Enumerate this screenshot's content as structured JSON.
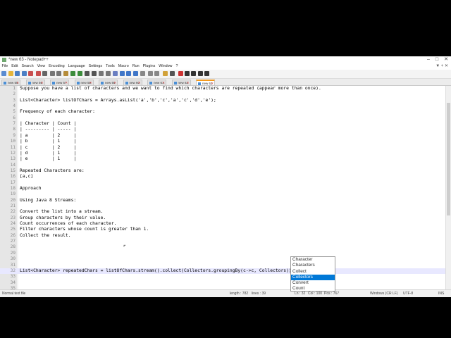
{
  "window": {
    "title": "*new 63 - Notepad++"
  },
  "menu": [
    "File",
    "Edit",
    "Search",
    "View",
    "Encoding",
    "Language",
    "Settings",
    "Tools",
    "Macro",
    "Run",
    "Plugins",
    "Window",
    "?"
  ],
  "tabs": [
    {
      "label": "new 55"
    },
    {
      "label": "new 56"
    },
    {
      "label": "new 57"
    },
    {
      "label": "new 58"
    },
    {
      "label": "new 59"
    },
    {
      "label": "new 60"
    },
    {
      "label": "new 61"
    },
    {
      "label": "new 62"
    },
    {
      "label": "new 63",
      "active": true
    }
  ],
  "lines": [
    "Suppose you have a list of characters and we want to find which characters are repeated (appear more than once).",
    "",
    "List<Character> listOfChars = Arrays.asList('a','b','c','a','c','d','e');",
    "",
    "Frequency of each character:",
    "",
    "| Character | Count |",
    "| --------- | ----- |",
    "| a         | 2     |",
    "| b         | 1     |",
    "| c         | 2     |",
    "| d         | 1     |",
    "| e         | 1     |",
    "",
    "Repeated Characters are:",
    "[a,c]",
    "",
    "Approach",
    "",
    "Using Java 8 Streams:",
    "",
    "Convert the list into a stream.",
    "Group characters by their value.",
    "Count occurrences of each character.",
    "Filter characters whose count is greater than 1.",
    "Collect the result.",
    "",
    "",
    "",
    "",
    "",
    "List<Character> repeatedChars = listOfChars.stream().collect(Collectors.groupingBy(c->c, Collectors))",
    "",
    "",
    "",
    "",
    "",
    "",
    ""
  ],
  "current_line": 32,
  "autocomplete": {
    "options": [
      "Character",
      "Characters",
      "Collect",
      "Collectors",
      "Convert",
      "Count"
    ],
    "selected": "Collectors"
  },
  "status": {
    "file_type": "Normal text file",
    "length": "length : 782",
    "lines": "lines : 39",
    "ln": "Ln : 32",
    "col": "Col : 100",
    "pos": "Pos : 767",
    "eol": "Windows (CR LF)",
    "encoding": "UTF-8",
    "mode": "INS"
  },
  "colors": {
    "current_line": "#e8e8ff",
    "selection": "#0078d7",
    "active_tab": "#f39a1e"
  }
}
